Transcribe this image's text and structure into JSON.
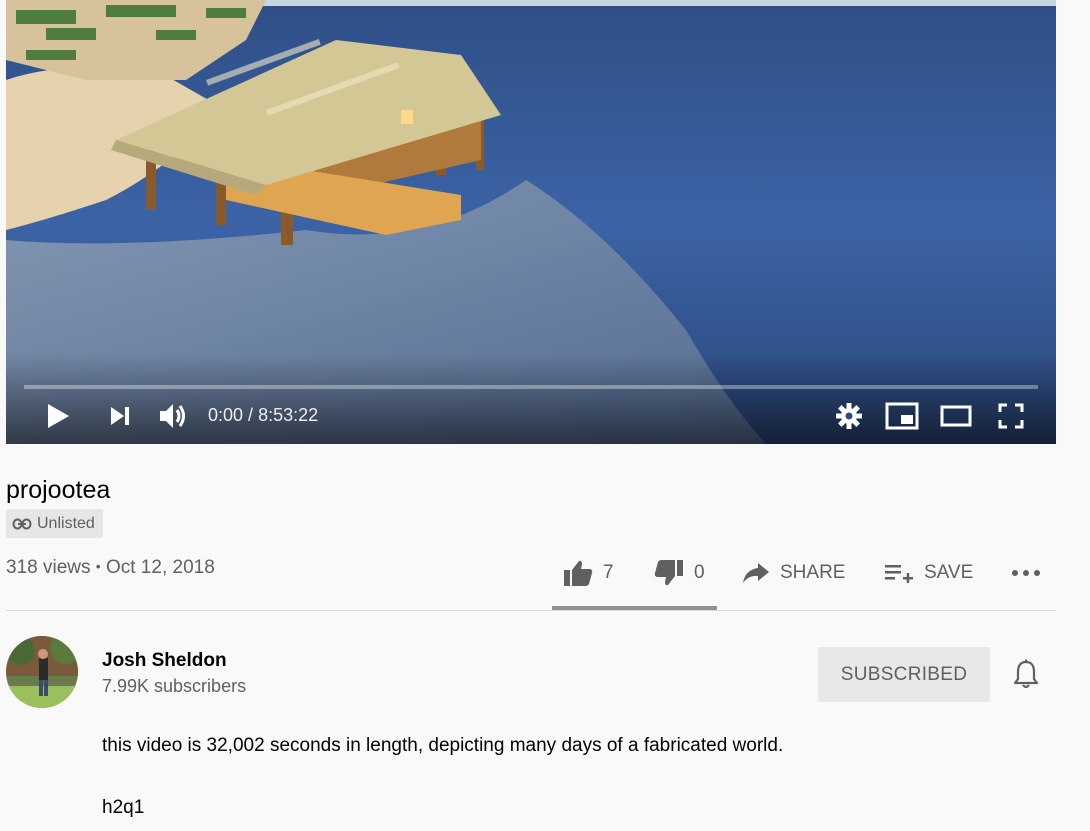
{
  "player": {
    "current_time": "0:00",
    "separator": " / ",
    "duration": "8:53:22",
    "progress_fraction": 0,
    "controls": [
      "play-icon",
      "next-icon",
      "volume-icon",
      "settings-icon",
      "miniplayer-icon",
      "theater-mode-icon",
      "fullscreen-icon"
    ]
  },
  "video": {
    "title": "projootea",
    "visibility": "Unlisted",
    "views": "318 views",
    "dot": "•",
    "date": "Oct 12, 2018"
  },
  "actions": {
    "likes": "7",
    "dislikes": "0",
    "share_label": "SHARE",
    "save_label": "SAVE"
  },
  "channel": {
    "name": "Josh Sheldon",
    "subscribers": "7.99K subscribers",
    "subscribe_label": "SUBSCRIBED"
  },
  "description": {
    "line1": "this video is 32,002 seconds in length, depicting many days of a fabricated world.",
    "line2": "h2q1"
  },
  "colors": {
    "progress_played": "#ff0000",
    "text_primary": "#030303",
    "text_secondary": "#606060",
    "background": "#f9f9f9"
  }
}
